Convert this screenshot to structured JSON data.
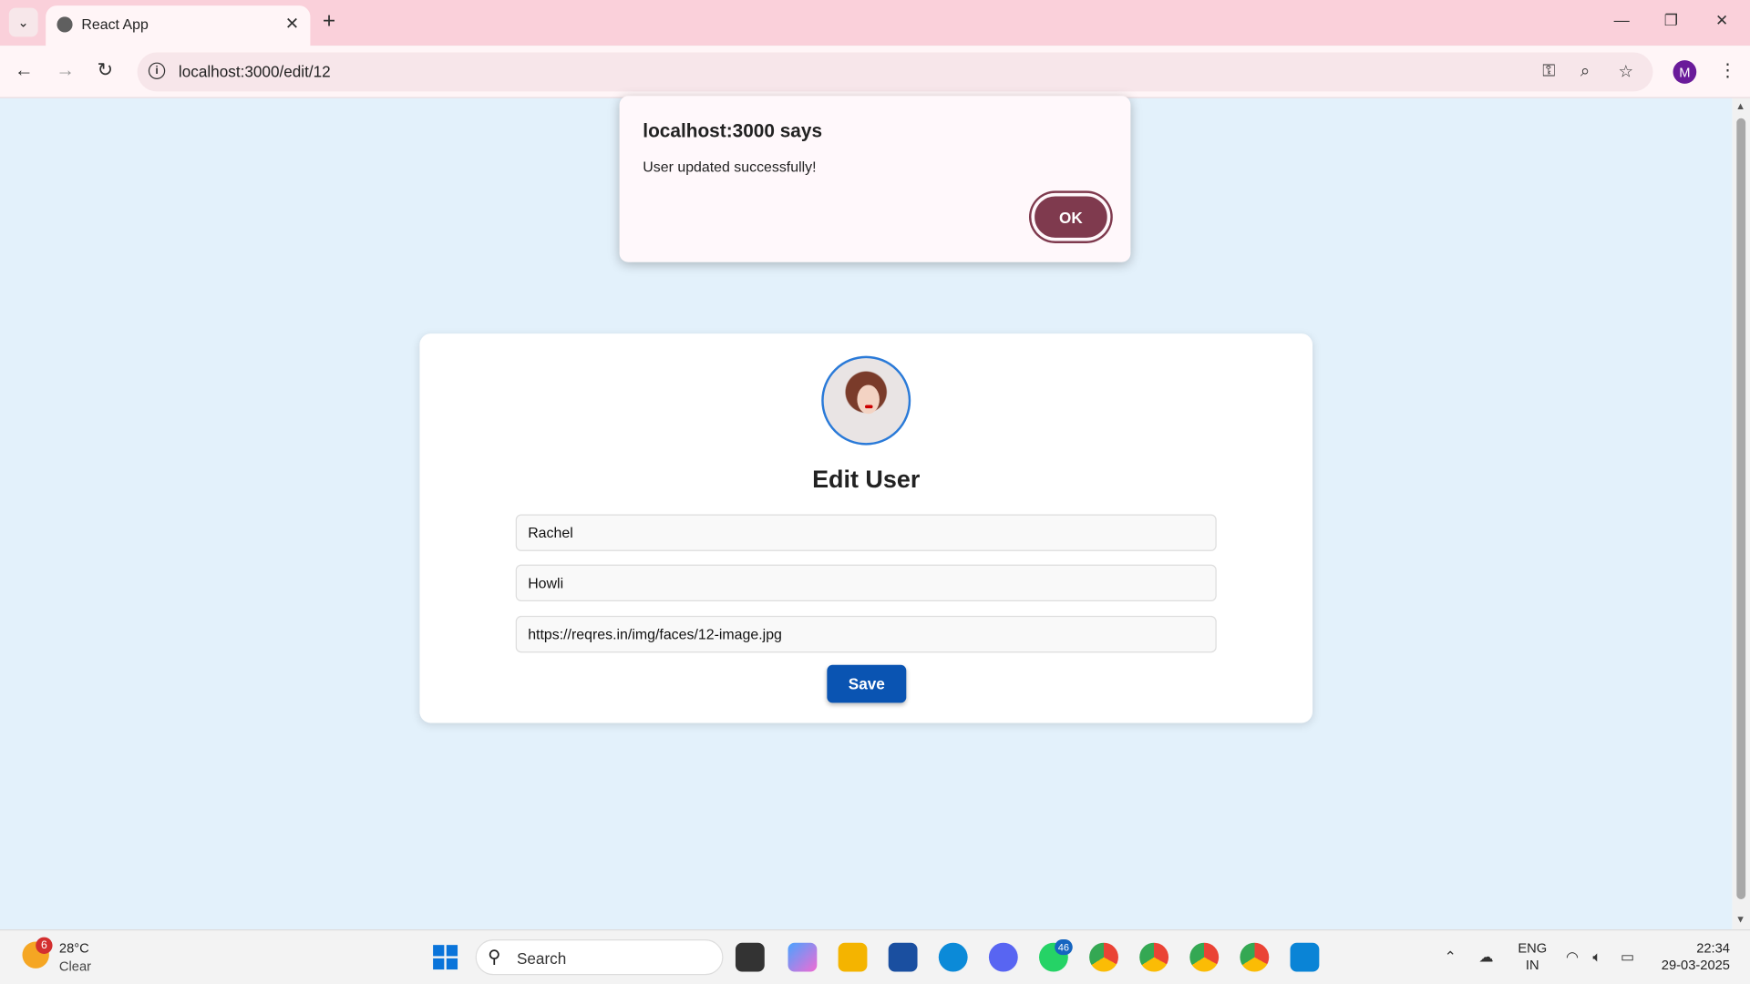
{
  "browser": {
    "tab_title": "React App",
    "url": "localhost:3000/edit/12",
    "profile_initial": "M"
  },
  "dialog": {
    "header": "localhost:3000 says",
    "message": "User updated successfully!",
    "ok_label": "OK"
  },
  "form": {
    "title": "Edit User",
    "first_name": "Rachel",
    "last_name": "Howli",
    "avatar_url": "https://reqres.in/img/faces/12-image.jpg",
    "save_label": "Save"
  },
  "taskbar": {
    "weather_badge": "6",
    "temperature": "28°C",
    "condition": "Clear",
    "search_label": "Search",
    "whatsapp_badge": "46",
    "lang_line1": "ENG",
    "lang_line2": "IN",
    "time": "22:34",
    "date": "29-03-2025"
  },
  "colors": {
    "titlebar": "#fad0da",
    "page_bg": "#e3f1fb",
    "ok_button": "#7f3a4e",
    "save_button": "#0a54b2"
  }
}
